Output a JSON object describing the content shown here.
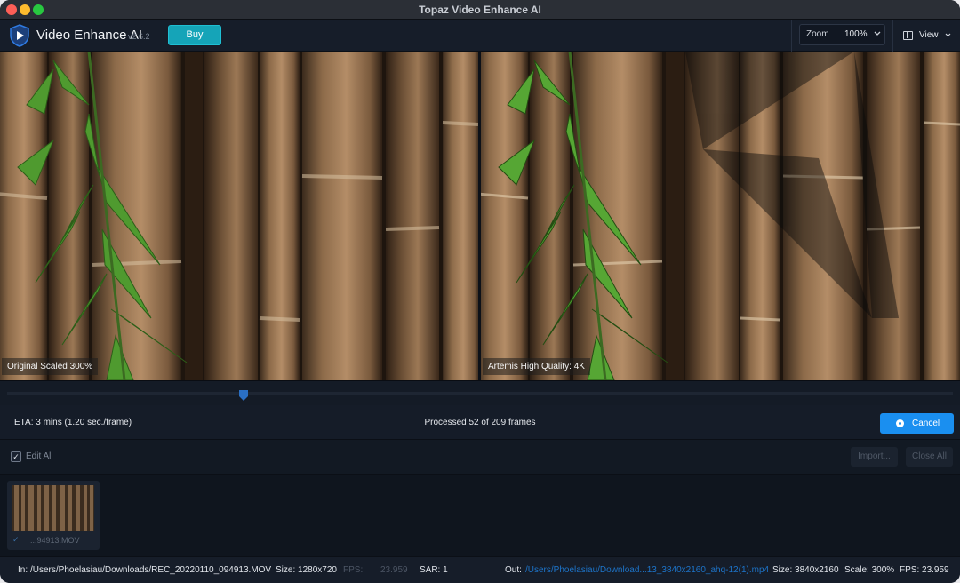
{
  "window": {
    "title": "Topaz Video Enhance AI"
  },
  "header": {
    "app_name": "Video Enhance AI",
    "version": "v2.6.2",
    "buy_label": "Buy",
    "zoom_label": "Zoom",
    "zoom_value": "100%",
    "view_label": "View"
  },
  "preview": {
    "left_label": "Original Scaled 300%",
    "right_label": "Artemis High Quality: 4K"
  },
  "timeline": {
    "position": 0.25
  },
  "status": {
    "eta": "ETA:  3 mins  (1.20 sec./frame)",
    "processed": "Processed 52 of 209 frames",
    "cancel_label": "Cancel"
  },
  "edit": {
    "edit_all_label": "Edit All",
    "import_label": "Import...",
    "close_all_label": "Close All"
  },
  "thumbs": [
    {
      "name": "...94913.MOV"
    }
  ],
  "info": {
    "in_label": "In:",
    "in_path": "/Users/Phoelasiau/Downloads/REC_20220110_094913.MOV",
    "in_size": "Size: 1280x720",
    "in_fps_label": "FPS:",
    "in_fps_value": "23.959",
    "in_sar": "SAR: 1",
    "out_label": "Out:",
    "out_path": "/Users/Phoelasiau/Download...13_3840x2160_ahq-12(1).mp4",
    "out_size": "Size: 3840x2160",
    "out_scale": "Scale: 300%",
    "out_fps": "FPS: 23.959"
  }
}
